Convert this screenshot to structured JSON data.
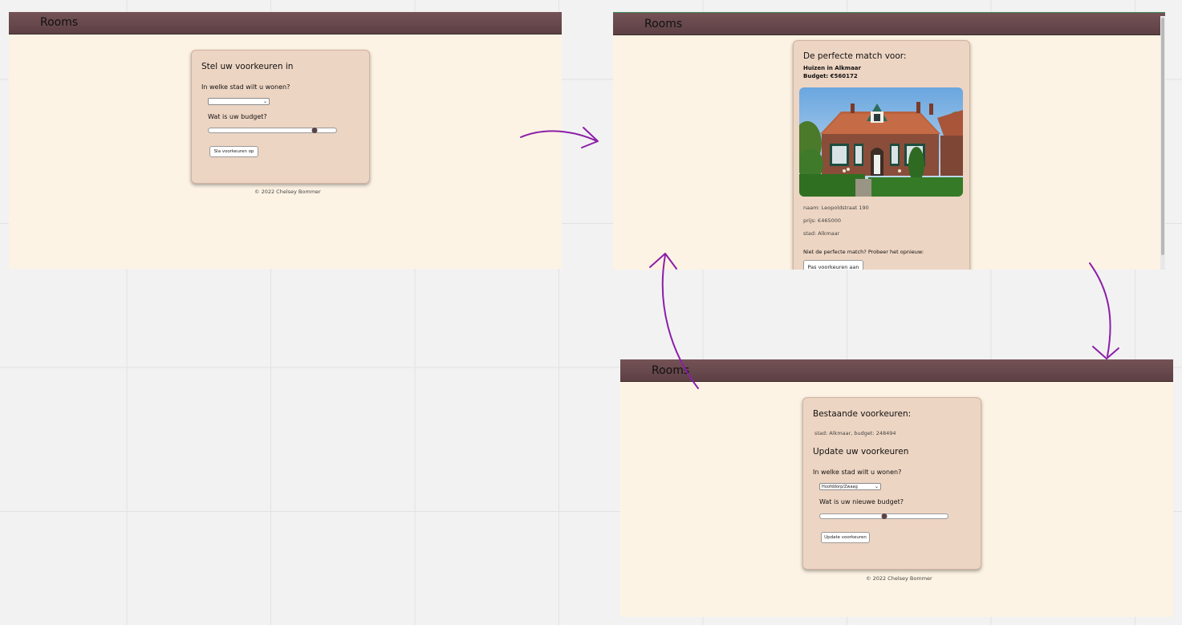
{
  "app": {
    "title": "Rooms",
    "footer": "© 2022 Chelsey Bommer"
  },
  "screen1": {
    "heading": "Stel uw voorkeuren in",
    "city_question": "In welke stad wilt u wonen?",
    "city_value": "",
    "budget_question": "Wat is uw budget?",
    "budget_fraction": 0.83,
    "save_button": "Sla voorkeuren op"
  },
  "screen2": {
    "heading": "De perfecte match voor:",
    "subheading": "Huizen in Alkmaar",
    "budget": "Budget: €560172",
    "naam": "naam: Leopoldstraat 190",
    "prijs": "prijs: €465000",
    "stad": "stad: Alkmaar",
    "retry_text": "Niet de perfecte match? Probeer het opnieuw:",
    "adjust_button": "Pas voorkeuren aan"
  },
  "screen3": {
    "existing_heading": "Bestaande voorkeuren:",
    "existing_value": "stad: Alkmaar, budget: 248494",
    "update_heading": "Update uw voorkeuren",
    "city_question": "In welke stad wilt u wonen?",
    "city_value": "Hoofddorp/Zwaag",
    "budget_question": "Wat is uw nieuwe budget?",
    "budget_fraction": 0.5,
    "update_button": "Update voorkeuren"
  },
  "colors": {
    "header": "#6a4b4f",
    "page_background": "#fdf3e4",
    "card_background": "#edd5c3",
    "arrow": "#8b1fa8"
  }
}
